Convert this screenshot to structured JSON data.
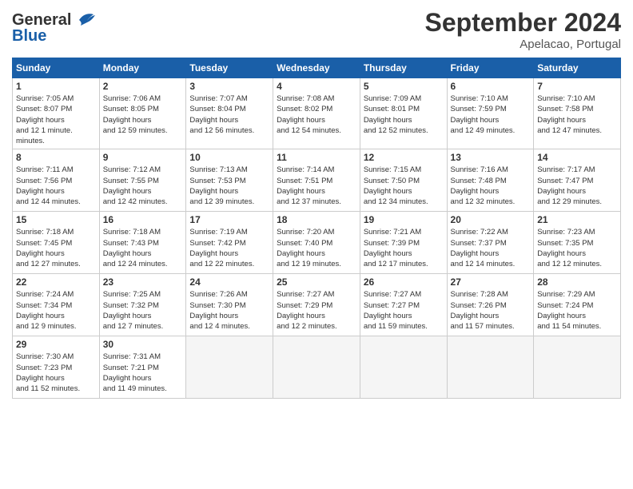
{
  "header": {
    "logo_line1": "General",
    "logo_line2": "Blue",
    "month_title": "September 2024",
    "location": "Apelacao, Portugal"
  },
  "days_of_week": [
    "Sunday",
    "Monday",
    "Tuesday",
    "Wednesday",
    "Thursday",
    "Friday",
    "Saturday"
  ],
  "weeks": [
    [
      {
        "day": 1,
        "sunrise": "7:05 AM",
        "sunset": "8:07 PM",
        "daylight": "12 hours and 1 minute."
      },
      {
        "day": 2,
        "sunrise": "7:06 AM",
        "sunset": "8:05 PM",
        "daylight": "12 hours and 59 minutes."
      },
      {
        "day": 3,
        "sunrise": "7:07 AM",
        "sunset": "8:04 PM",
        "daylight": "12 hours and 56 minutes."
      },
      {
        "day": 4,
        "sunrise": "7:08 AM",
        "sunset": "8:02 PM",
        "daylight": "12 hours and 54 minutes."
      },
      {
        "day": 5,
        "sunrise": "7:09 AM",
        "sunset": "8:01 PM",
        "daylight": "12 hours and 52 minutes."
      },
      {
        "day": 6,
        "sunrise": "7:10 AM",
        "sunset": "7:59 PM",
        "daylight": "12 hours and 49 minutes."
      },
      {
        "day": 7,
        "sunrise": "7:10 AM",
        "sunset": "7:58 PM",
        "daylight": "12 hours and 47 minutes."
      }
    ],
    [
      {
        "day": 8,
        "sunrise": "7:11 AM",
        "sunset": "7:56 PM",
        "daylight": "12 hours and 44 minutes."
      },
      {
        "day": 9,
        "sunrise": "7:12 AM",
        "sunset": "7:55 PM",
        "daylight": "12 hours and 42 minutes."
      },
      {
        "day": 10,
        "sunrise": "7:13 AM",
        "sunset": "7:53 PM",
        "daylight": "12 hours and 39 minutes."
      },
      {
        "day": 11,
        "sunrise": "7:14 AM",
        "sunset": "7:51 PM",
        "daylight": "12 hours and 37 minutes."
      },
      {
        "day": 12,
        "sunrise": "7:15 AM",
        "sunset": "7:50 PM",
        "daylight": "12 hours and 34 minutes."
      },
      {
        "day": 13,
        "sunrise": "7:16 AM",
        "sunset": "7:48 PM",
        "daylight": "12 hours and 32 minutes."
      },
      {
        "day": 14,
        "sunrise": "7:17 AM",
        "sunset": "7:47 PM",
        "daylight": "12 hours and 29 minutes."
      }
    ],
    [
      {
        "day": 15,
        "sunrise": "7:18 AM",
        "sunset": "7:45 PM",
        "daylight": "12 hours and 27 minutes."
      },
      {
        "day": 16,
        "sunrise": "7:18 AM",
        "sunset": "7:43 PM",
        "daylight": "12 hours and 24 minutes."
      },
      {
        "day": 17,
        "sunrise": "7:19 AM",
        "sunset": "7:42 PM",
        "daylight": "12 hours and 22 minutes."
      },
      {
        "day": 18,
        "sunrise": "7:20 AM",
        "sunset": "7:40 PM",
        "daylight": "12 hours and 19 minutes."
      },
      {
        "day": 19,
        "sunrise": "7:21 AM",
        "sunset": "7:39 PM",
        "daylight": "12 hours and 17 minutes."
      },
      {
        "day": 20,
        "sunrise": "7:22 AM",
        "sunset": "7:37 PM",
        "daylight": "12 hours and 14 minutes."
      },
      {
        "day": 21,
        "sunrise": "7:23 AM",
        "sunset": "7:35 PM",
        "daylight": "12 hours and 12 minutes."
      }
    ],
    [
      {
        "day": 22,
        "sunrise": "7:24 AM",
        "sunset": "7:34 PM",
        "daylight": "12 hours and 9 minutes."
      },
      {
        "day": 23,
        "sunrise": "7:25 AM",
        "sunset": "7:32 PM",
        "daylight": "12 hours and 7 minutes."
      },
      {
        "day": 24,
        "sunrise": "7:26 AM",
        "sunset": "7:30 PM",
        "daylight": "12 hours and 4 minutes."
      },
      {
        "day": 25,
        "sunrise": "7:27 AM",
        "sunset": "7:29 PM",
        "daylight": "12 hours and 2 minutes."
      },
      {
        "day": 26,
        "sunrise": "7:27 AM",
        "sunset": "7:27 PM",
        "daylight": "11 hours and 59 minutes."
      },
      {
        "day": 27,
        "sunrise": "7:28 AM",
        "sunset": "7:26 PM",
        "daylight": "11 hours and 57 minutes."
      },
      {
        "day": 28,
        "sunrise": "7:29 AM",
        "sunset": "7:24 PM",
        "daylight": "11 hours and 54 minutes."
      }
    ],
    [
      {
        "day": 29,
        "sunrise": "7:30 AM",
        "sunset": "7:23 PM",
        "daylight": "11 hours and 52 minutes."
      },
      {
        "day": 30,
        "sunrise": "7:31 AM",
        "sunset": "7:21 PM",
        "daylight": "11 hours and 49 minutes."
      },
      null,
      null,
      null,
      null,
      null
    ]
  ]
}
